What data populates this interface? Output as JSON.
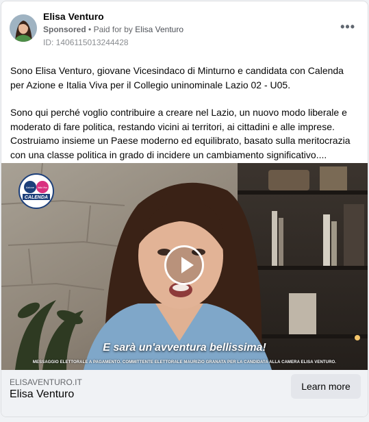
{
  "advertiser": {
    "name": "Elisa Venturo",
    "sponsored_label": "Sponsored",
    "separator": "•",
    "paid_for_label": "Paid for by",
    "paid_for_name": "Elisa Venturo",
    "ad_id": "ID: 1406115013244428"
  },
  "more_options": "•••",
  "body": {
    "paragraph_1": "Sono Elisa Venturo, giovane Vicesindaco di Minturno e candidata con Calenda per Azione e Italia Viva per il Collegio uninominale Lazio 02 - U05.",
    "paragraph_2": "Sono qui perché voglio contribuire a creare nel Lazio, un nuovo modo liberale e moderato di fare politica, restando vicini ai territori, ai cittadini e alle imprese. Costruiamo insieme un Paese moderno ed equilibrato, basato sulla meritocrazia con una classe politica in grado di incidere un cambiamento significativo...."
  },
  "video": {
    "caption": "E sarà un'avventura bellissima!",
    "disclaimer": "MESSAGGIO ELETTORALE A PAGAMENTO. COMMITTENTE ELETTORALE MAURIZIO GRANATA PER LA CANDIDATA ALLA CAMERA ELISA VENTURO.",
    "logo": {
      "azione": "Azione",
      "italia_viva": "Italia Viva",
      "calenda": "CALENDA"
    }
  },
  "link_preview": {
    "domain": "ELISAVENTURO.IT",
    "title": "Elisa Venturo",
    "cta_label": "Learn more"
  },
  "colors": {
    "background": "#f0f2f5",
    "card": "#ffffff",
    "cta_bg": "#e4e6eb",
    "calenda_blue": "#1c3f7a"
  },
  "icons": {
    "more_options": "ellipsis-icon",
    "play": "play-icon"
  }
}
